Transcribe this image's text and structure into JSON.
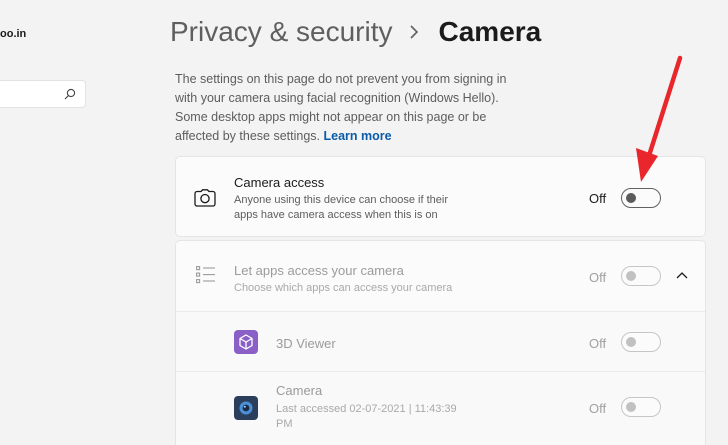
{
  "sidebar": {
    "account_email_fragment": "oo.in",
    "search": {
      "placeholder": "",
      "icon": "search-icon"
    }
  },
  "breadcrumb": {
    "parent": "Privacy & security",
    "separator_icon": "chevron-right-icon",
    "current": "Camera"
  },
  "description": {
    "text": "The settings on this page do not prevent you from signing in with your camera using facial recognition (Windows Hello). Some desktop apps might not appear on this page or be affected by these settings.",
    "link": "Learn more"
  },
  "camera_access": {
    "icon": "camera-icon",
    "title": "Camera access",
    "subtitle_line1": "Anyone using this device can choose if their",
    "subtitle_line2": "apps have camera access when this is on",
    "state": "Off",
    "enabled": false
  },
  "let_apps_access": {
    "icon": "app-list-icon",
    "title": "Let apps access your camera",
    "subtitle": "Choose which apps can access your camera",
    "state": "Off",
    "enabled": false,
    "expand_icon": "chevron-up-icon"
  },
  "apps": [
    {
      "name": "3D Viewer",
      "icon": "3d-viewer-icon",
      "state": "Off"
    },
    {
      "name": "Camera",
      "icon": "camera-app-icon",
      "last_accessed_line1": "Last accessed 02-07-2021  |  11:43:39",
      "last_accessed_line2": "PM",
      "state": "Off"
    }
  ],
  "colors": {
    "accent_link": "#0a5ca8",
    "annotation_arrow": "#e8262b",
    "background": "#f3f3f3",
    "card": "#fbfbfb"
  }
}
